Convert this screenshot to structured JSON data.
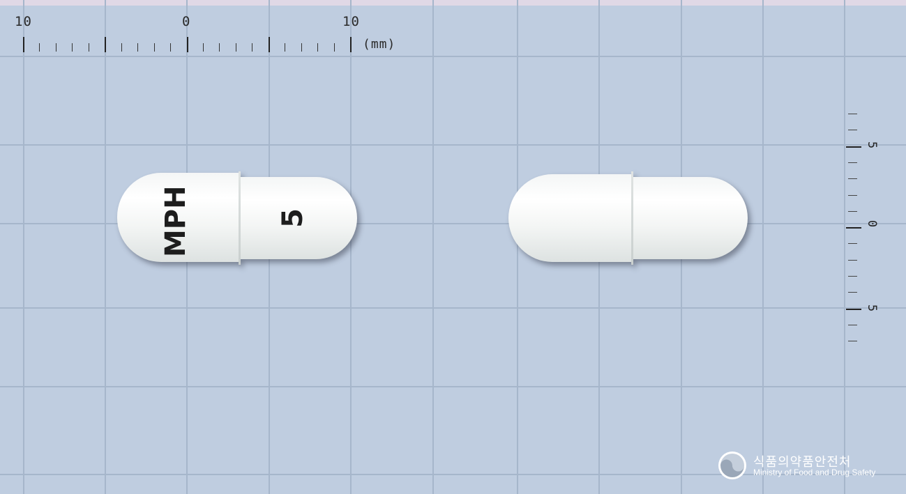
{
  "ruler": {
    "top_labels": [
      "10",
      "0",
      "10"
    ],
    "unit": "(mm)",
    "side_labels": [
      "5",
      "0",
      "5"
    ]
  },
  "capsule_front": {
    "imprint_top": "MPH",
    "imprint_bottom": "5",
    "color": "#ffffff"
  },
  "capsule_back": {
    "color": "#ffffff"
  },
  "logo": {
    "name_ko": "식품의약품안전처",
    "name_en": "Ministry of Food and Drug Safety"
  },
  "colors": {
    "background": "#bfcde0",
    "grid": "#a6b6cb"
  }
}
